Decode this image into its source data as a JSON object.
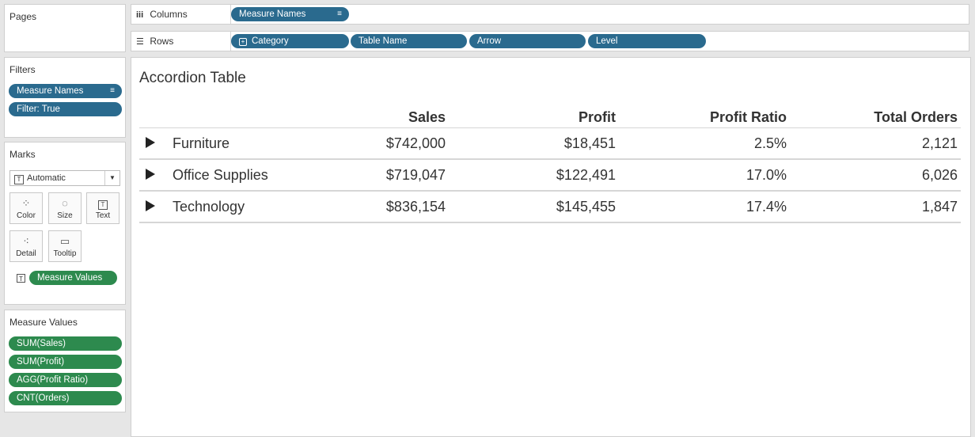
{
  "pages_panel": {
    "title": "Pages"
  },
  "filters_panel": {
    "title": "Filters",
    "pills": [
      "Measure Names",
      "Filter: True"
    ]
  },
  "marks_panel": {
    "title": "Marks",
    "mark_type": "Automatic",
    "buttons": [
      "Color",
      "Size",
      "Text",
      "Detail",
      "Tooltip"
    ],
    "text_pill": "Measure Values"
  },
  "measure_values_panel": {
    "title": "Measure Values",
    "pills": [
      "SUM(Sales)",
      "SUM(Profit)",
      "AGG(Profit Ratio)",
      "CNT(Orders)"
    ]
  },
  "columns_shelf": {
    "label": "Columns",
    "pills": [
      "Measure Names"
    ]
  },
  "rows_shelf": {
    "label": "Rows",
    "pills": [
      "Category",
      "Table Name",
      "Arrow",
      "Level"
    ]
  },
  "sheet": {
    "title": "Accordion Table",
    "columns": [
      "Sales",
      "Profit",
      "Profit Ratio",
      "Total Orders"
    ],
    "rows": [
      {
        "category": "Furniture",
        "sales": "$742,000",
        "profit": "$18,451",
        "ratio": "2.5%",
        "orders": "2,121"
      },
      {
        "category": "Office Supplies",
        "sales": "$719,047",
        "profit": "$122,491",
        "ratio": "17.0%",
        "orders": "6,026"
      },
      {
        "category": "Technology",
        "sales": "$836,154",
        "profit": "$145,455",
        "ratio": "17.4%",
        "orders": "1,847"
      }
    ]
  },
  "colors": {
    "blue_pill": "#2a6a8e",
    "green_pill": "#2d8a4e"
  }
}
